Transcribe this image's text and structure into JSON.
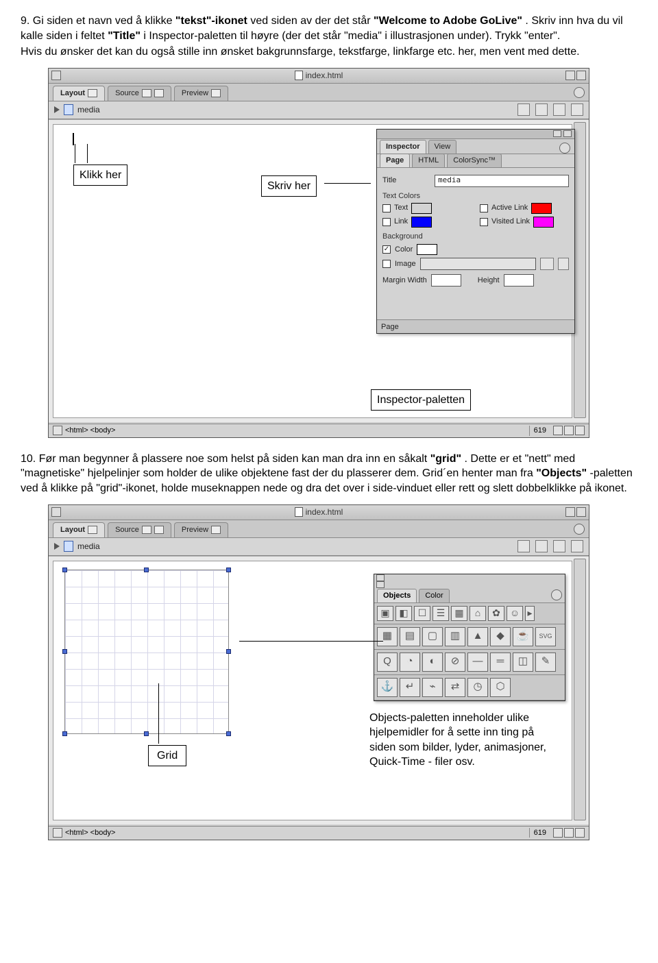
{
  "step9": {
    "num": "9.",
    "text_parts": {
      "p1": " Gi siden et navn ved å klikke ",
      "b1": "\"tekst\"-ikonet",
      "p2": " ved siden av der det står ",
      "b2": "\"Welcome to Adobe GoLive\"",
      "p3": ". Skriv inn hva du vil kalle siden i feltet ",
      "b3": "\"Title\"",
      "p4": " i Inspector-paletten til høyre (der det står \"media\" i illustrasjonen under). Trykk \"enter\".",
      "line2": "Hvis du ønsker det kan du også stille inn ønsket bakgrunnsfarge, tekstfarge, linkfarge etc. her, men vent med dette."
    }
  },
  "shot1": {
    "window_title": "index.html",
    "tabs": {
      "layout": "Layout",
      "source": "Source",
      "preview": "Preview"
    },
    "page_title_field": "media",
    "statusbar": {
      "path": "<html>  <body>",
      "num": "619"
    },
    "inspector": {
      "tabs": {
        "inspector": "Inspector",
        "view": "View"
      },
      "subtabs": {
        "page": "Page",
        "html": "HTML",
        "colorsync": "ColorSync™"
      },
      "title_label": "Title",
      "title_value": "media",
      "text_colors_label": "Text Colors",
      "text_label": "Text",
      "link_label": "Link",
      "active_link_label": "Active Link",
      "visited_link_label": "Visited Link",
      "background_label": "Background",
      "color_label": "Color",
      "image_label": "Image",
      "margin_width_label": "Margin Width",
      "height_label": "Height",
      "footer": "Page",
      "colors": {
        "text": "#000000",
        "link": "#0000ff",
        "active": "#ff0000",
        "visited": "#ff00ff",
        "bg": "#ffffff"
      }
    },
    "callouts": {
      "klikk_her": "Klikk her",
      "skriv_her": "Skriv her",
      "inspector_paletten": "Inspector-paletten"
    }
  },
  "step10": {
    "num": "10.",
    "text_parts": {
      "p1": "Før man begynner å plassere noe som helst på siden kan man dra inn en såkalt ",
      "b1": "\"grid\"",
      "p2": ". Dette er et \"nett\" med \"magnetiske\" hjelpelinjer som holder de ulike objektene fast der du plasserer dem. Grid´en henter man fra ",
      "b2": "\"Objects\"",
      "p3": "-paletten ved å klikke på \"grid\"-ikonet, holde museknappen nede og dra det over i side-vinduet eller rett og slett dobbelklikke på ikonet."
    }
  },
  "shot2": {
    "window_title": "index.html",
    "tabs": {
      "layout": "Layout",
      "source": "Source",
      "preview": "Preview"
    },
    "page_title_field": "media",
    "objects": {
      "tabs": {
        "objects": "Objects",
        "color": "Color"
      }
    },
    "callouts": {
      "grid": "Grid",
      "objects_text": "Objects-paletten inneholder ulike hjelpemidler for å sette inn ting på siden som bilder, lyder, animasjoner, Quick-Time - filer osv."
    },
    "statusbar": {
      "path": "<html>  <body>",
      "num": "619"
    }
  }
}
